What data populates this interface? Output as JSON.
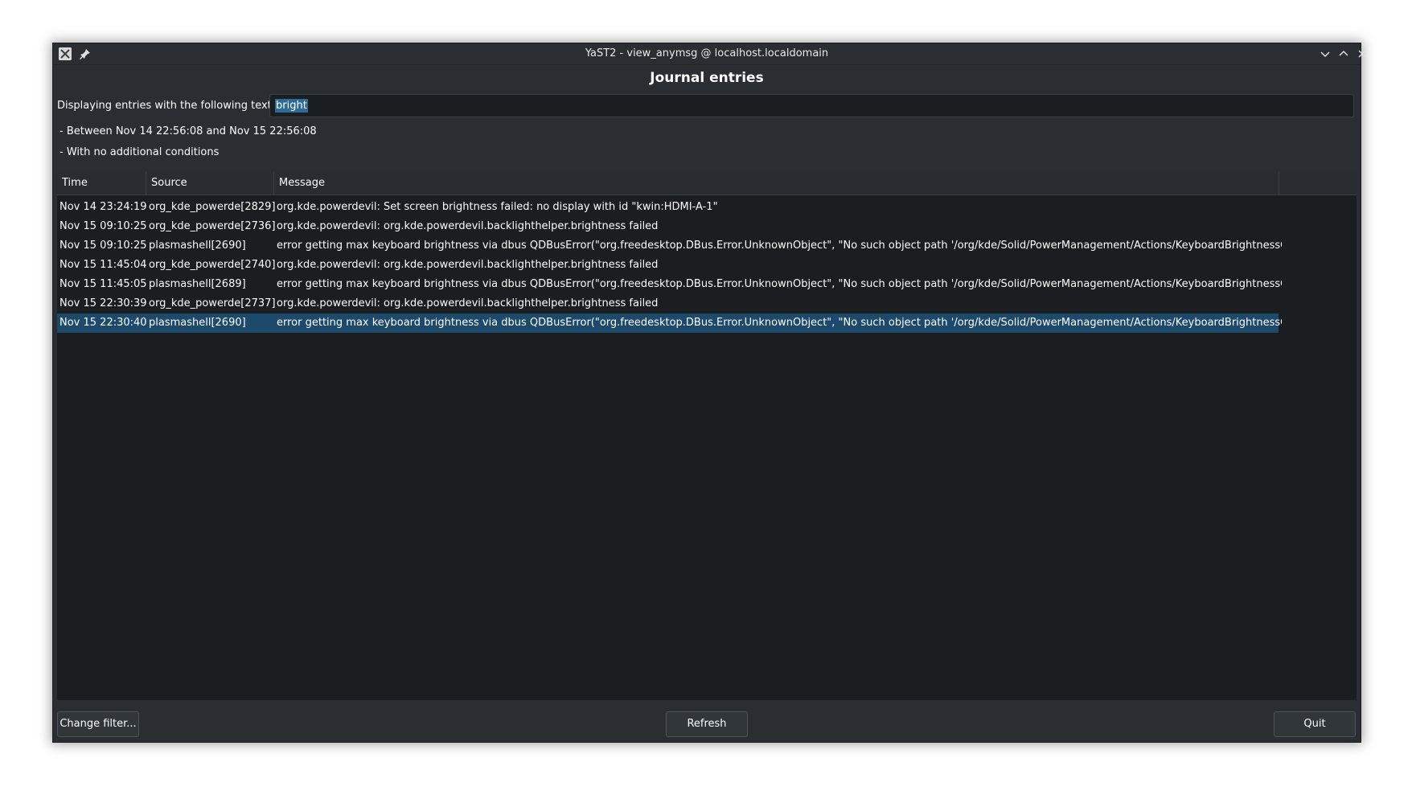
{
  "window": {
    "title": "YaST2 - view_anymsg @ localhost.localdomain"
  },
  "heading": "Journal entries",
  "filter": {
    "label": "Displaying entries with the following text",
    "value": "bright"
  },
  "conditions": [
    "- Between Nov 14 22:56:08 and Nov 15 22:56:08",
    "- With no additional conditions"
  ],
  "table": {
    "columns": [
      "Time",
      "Source",
      "Message"
    ],
    "rows": [
      {
        "time": "Nov 14 23:24:19",
        "source": "org_kde_powerde[2829]",
        "message": "org.kde.powerdevil: Set screen brightness failed: no display with id \"kwin:HDMI-A-1\"",
        "selected": false
      },
      {
        "time": "Nov 15 09:10:25",
        "source": "org_kde_powerde[2736]",
        "message": "org.kde.powerdevil: org.kde.powerdevil.backlighthelper.brightness failed",
        "selected": false
      },
      {
        "time": "Nov 15 09:10:25",
        "source": "plasmashell[2690]",
        "message": "error getting max keyboard brightness via dbus QDBusError(\"org.freedesktop.DBus.Error.UnknownObject\", \"No such object path '/org/kde/Solid/PowerManagement/Actions/KeyboardBrightnessControl'\")",
        "selected": false
      },
      {
        "time": "Nov 15 11:45:04",
        "source": "org_kde_powerde[2740]",
        "message": "org.kde.powerdevil: org.kde.powerdevil.backlighthelper.brightness failed",
        "selected": false
      },
      {
        "time": "Nov 15 11:45:05",
        "source": "plasmashell[2689]",
        "message": "error getting max keyboard brightness via dbus QDBusError(\"org.freedesktop.DBus.Error.UnknownObject\", \"No such object path '/org/kde/Solid/PowerManagement/Actions/KeyboardBrightnessControl'\")",
        "selected": false
      },
      {
        "time": "Nov 15 22:30:39",
        "source": "org_kde_powerde[2737]",
        "message": "org.kde.powerdevil: org.kde.powerdevil.backlighthelper.brightness failed",
        "selected": false
      },
      {
        "time": "Nov 15 22:30:40",
        "source": "plasmashell[2690]",
        "message": "error getting max keyboard brightness via dbus QDBusError(\"org.freedesktop.DBus.Error.UnknownObject\", \"No such object path '/org/kde/Solid/PowerManagement/Actions/KeyboardBrightnessControl'\")",
        "selected": true
      }
    ]
  },
  "buttons": {
    "change_filter": "Change filter...",
    "refresh": "Refresh",
    "quit": "Quit"
  },
  "colors": {
    "background": "#1b1e20",
    "window": "#2a2e32",
    "selection": "#1d4a6a",
    "text": "#fcfcfc"
  },
  "icons": {
    "app": "yast-app-icon",
    "pin": "pin-icon",
    "minimize": "chevron-down-icon",
    "maximize": "chevron-up-icon",
    "close": "close-icon"
  }
}
